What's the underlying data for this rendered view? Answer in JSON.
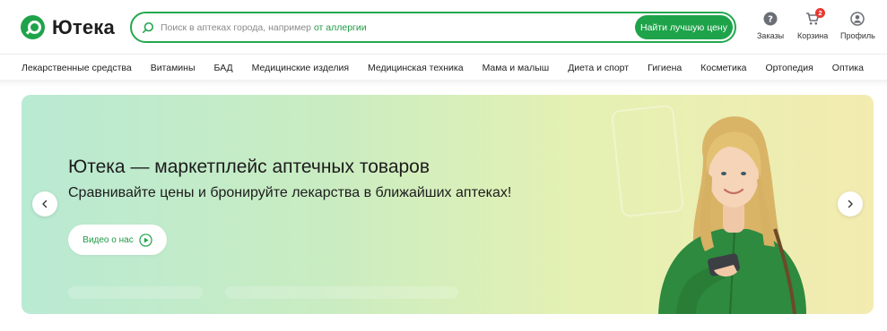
{
  "header": {
    "logo_text": "Ютека",
    "search": {
      "placeholder": "Поиск в аптеках города, например",
      "hint": "от аллергии",
      "button_label": "Найти лучшую цену"
    },
    "actions": [
      {
        "label": "Заказы",
        "icon": "question-icon"
      },
      {
        "label": "Корзина",
        "icon": "cart-icon",
        "badge": "2"
      },
      {
        "label": "Профиль",
        "icon": "user-icon"
      }
    ]
  },
  "nav": {
    "items": [
      "Лекарственные средства",
      "Витамины",
      "БАД",
      "Медицинские изделия",
      "Медицинская техника",
      "Мама и малыш",
      "Диета и спорт",
      "Гигиена",
      "Косметика",
      "Ортопедия",
      "Оптика"
    ]
  },
  "banner": {
    "title": "Ютека — маркетплейс аптечных товаров",
    "subtitle": "Сравнивайте цены и бронируйте лекарства в ближайших аптеках!",
    "video_button": "Видео о нас",
    "colors": {
      "accent": "#1fa34a",
      "gradient_start": "#b9ead3",
      "gradient_end": "#f3ebb0"
    }
  }
}
